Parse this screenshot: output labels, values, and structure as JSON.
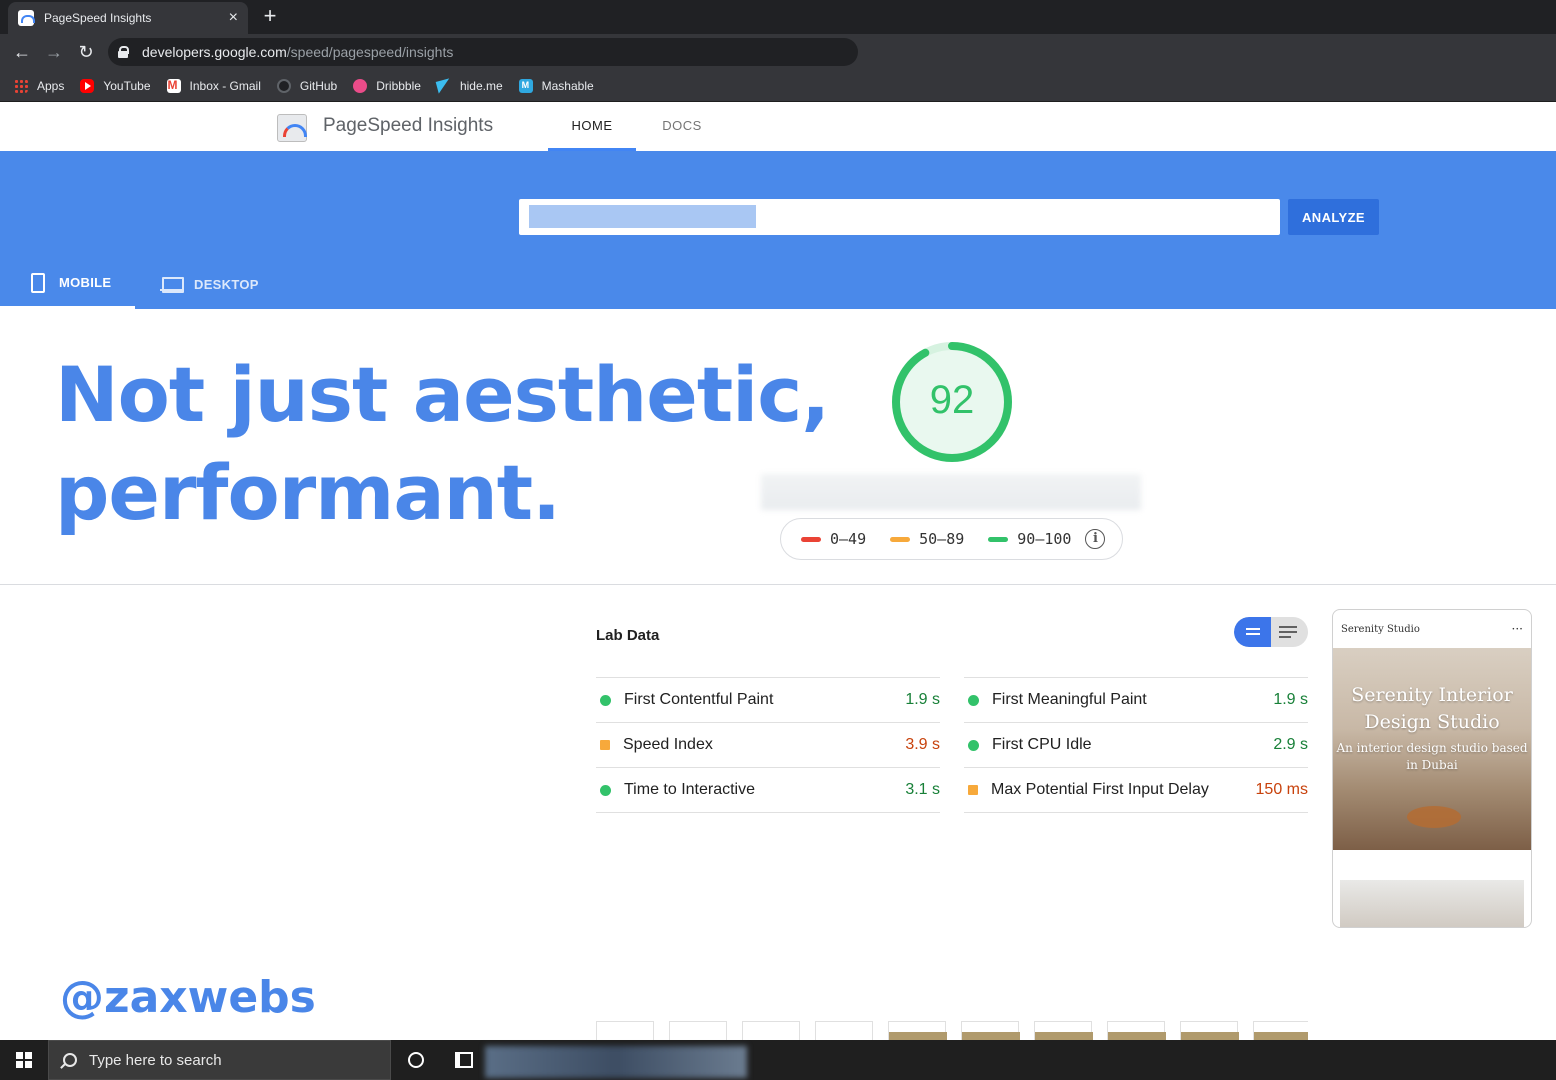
{
  "browser": {
    "tab_title": "PageSpeed Insights",
    "tab_close": "×",
    "new_tab": "+",
    "url_host": "developers.google.com",
    "url_path": "/speed/pagespeed/insights",
    "bookmarks": [
      {
        "label": "Apps",
        "icon": "apps-icon"
      },
      {
        "label": "YouTube",
        "icon": "youtube-icon"
      },
      {
        "label": "Inbox - Gmail",
        "icon": "gmail-icon"
      },
      {
        "label": "GitHub",
        "icon": "github-icon"
      },
      {
        "label": "Dribbble",
        "icon": "dribbble-icon"
      },
      {
        "label": "hide.me",
        "icon": "hideme-icon"
      },
      {
        "label": "Mashable",
        "icon": "mashable-icon"
      }
    ]
  },
  "psi": {
    "brand": "PageSpeed Insights",
    "nav": {
      "home": "HOME",
      "docs": "DOCS"
    },
    "analyze_label": "ANALYZE",
    "tabs": {
      "mobile": "MOBILE",
      "desktop": "DESKTOP"
    },
    "score": "92",
    "score_fraction": 0.92,
    "legend": [
      "0–49",
      "50–89",
      "90–100"
    ],
    "legend_info": "i",
    "colors": {
      "fail": "#ff4e42",
      "average": "#ffa400",
      "pass": "#0cce6b",
      "accent": "#4285f4"
    }
  },
  "overlay": {
    "headline_line1": "Not just aesthetic,",
    "headline_line2": "performant.",
    "handle": "@zaxwebs"
  },
  "lab": {
    "title": "Lab Data",
    "left": [
      {
        "name": "First Contentful Paint",
        "value": "1.9 s",
        "status": "pass"
      },
      {
        "name": "Speed Index",
        "value": "3.9 s",
        "status": "average"
      },
      {
        "name": "Time to Interactive",
        "value": "3.1 s",
        "status": "pass"
      }
    ],
    "right": [
      {
        "name": "First Meaningful Paint",
        "value": "1.9 s",
        "status": "pass"
      },
      {
        "name": "First CPU Idle",
        "value": "2.9 s",
        "status": "pass"
      },
      {
        "name": "Max Potential First Input Delay",
        "value": "150 ms",
        "status": "average"
      }
    ]
  },
  "preview": {
    "site_name": "Serenity Studio",
    "menu": "···",
    "hero_title": "Serenity Interior Design Studio",
    "hero_sub": "An interior design studio based in Dubai"
  },
  "taskbar": {
    "search_placeholder": "Type here to search"
  }
}
